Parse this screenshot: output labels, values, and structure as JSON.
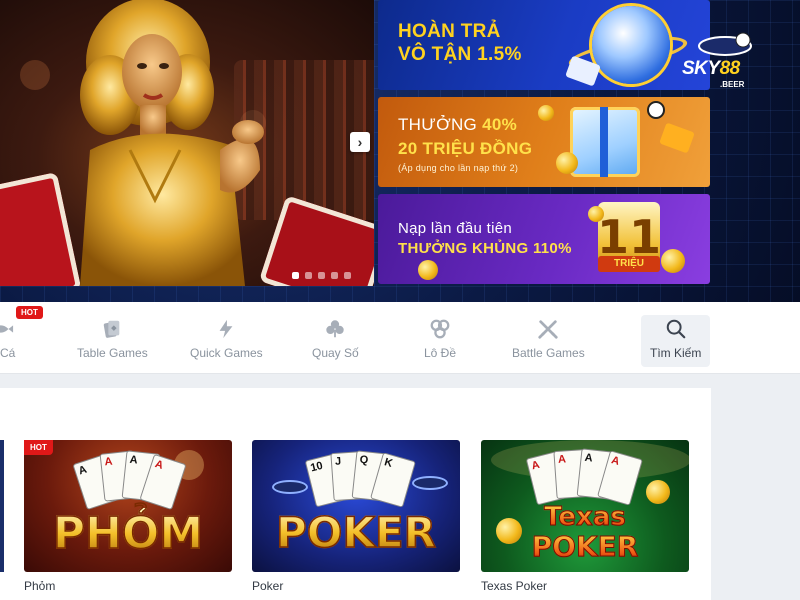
{
  "hero": {
    "slide_count": 5,
    "active_slide": 1,
    "next_arrow": "›",
    "promos": [
      {
        "line1": "HOÀN TRẢ",
        "line2": "VÔ TẬN 1.5%"
      },
      {
        "line1_prefix": "THƯỞNG ",
        "line1_highlight": "40%",
        "line2": "20 TRIỆU ĐỒNG",
        "line3": "(Áp dụng cho lần nạp thứ 2)"
      },
      {
        "line1": "Nạp lần đầu tiên",
        "line2": "THƯỞNG KHỦNG 110%",
        "badge_number": "11",
        "badge_label": "TRIỆU"
      }
    ],
    "logo": {
      "brand_a": "SKY",
      "brand_b": "88",
      "sub": ".BEER"
    }
  },
  "categories": {
    "hot_badge": "HOT",
    "items": [
      {
        "label": "n Cá",
        "icon": "fish-icon"
      },
      {
        "label": "Table Games",
        "icon": "cards-icon"
      },
      {
        "label": "Quick Games",
        "icon": "lightning-icon"
      },
      {
        "label": "Quay Số",
        "icon": "clover-icon"
      },
      {
        "label": "Lô Đề",
        "icon": "lottery-balls-icon"
      },
      {
        "label": "Battle Games",
        "icon": "crossed-swords-icon"
      },
      {
        "label": "Tìm Kiếm",
        "icon": "search-icon",
        "active": true
      }
    ]
  },
  "games": {
    "hot_label": "HOT",
    "items": [
      {
        "title": "Phỏm",
        "art_text": "PHỎM",
        "hot": true
      },
      {
        "title": "Poker",
        "art_text": "POKER"
      },
      {
        "title": "Texas Poker",
        "art_text_1": "Texas",
        "art_text_2": "POKER"
      }
    ],
    "card_faces": {
      "a": "A",
      "j": "J",
      "q": "Q",
      "k": "K",
      "ten": "10"
    }
  },
  "colors": {
    "accent_gold": "#ffd21f",
    "hot_red": "#e01818",
    "nav_text": "#8a939e",
    "active_tab_bg": "#eef1f5"
  }
}
